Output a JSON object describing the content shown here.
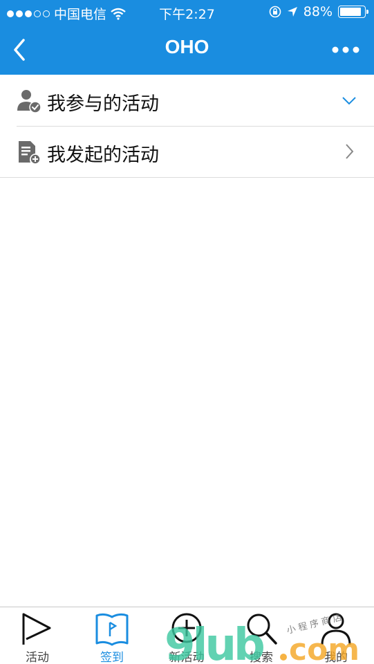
{
  "status_bar": {
    "carrier": "中国电信",
    "time": "下午2:27",
    "battery": "88%",
    "signal_icon": "signal-dots-icon",
    "wifi_icon": "wifi-icon",
    "location_icon": "location-arrow-icon",
    "lock_icon": "orientation-lock-icon"
  },
  "nav": {
    "title": "OHO",
    "back_icon": "chevron-left-icon",
    "more_icon": "more-dots-icon"
  },
  "list": {
    "items": [
      {
        "label": "我参与的活动",
        "icon": "user-check-icon",
        "indicator": "chevron-down-icon"
      },
      {
        "label": "我发起的活动",
        "icon": "document-add-icon",
        "indicator": "chevron-right-icon"
      }
    ]
  },
  "tabs": [
    {
      "label": "活动",
      "icon": "flag-icon",
      "active": false
    },
    {
      "label": "签到",
      "icon": "book-icon",
      "active": true
    },
    {
      "label": "新活动",
      "icon": "plus-circle-icon",
      "active": false
    },
    {
      "label": "搜索",
      "icon": "search-icon",
      "active": false
    },
    {
      "label": "我的",
      "icon": "person-icon",
      "active": false
    }
  ],
  "watermark": {
    "text": "9lub.com",
    "subtext": "小程序商店"
  },
  "colors": {
    "primary": "#1a8de0",
    "text": "#111111",
    "divider": "#dcdcdc",
    "watermark_green": "#3cc8a0",
    "watermark_orange": "#f5a623"
  }
}
